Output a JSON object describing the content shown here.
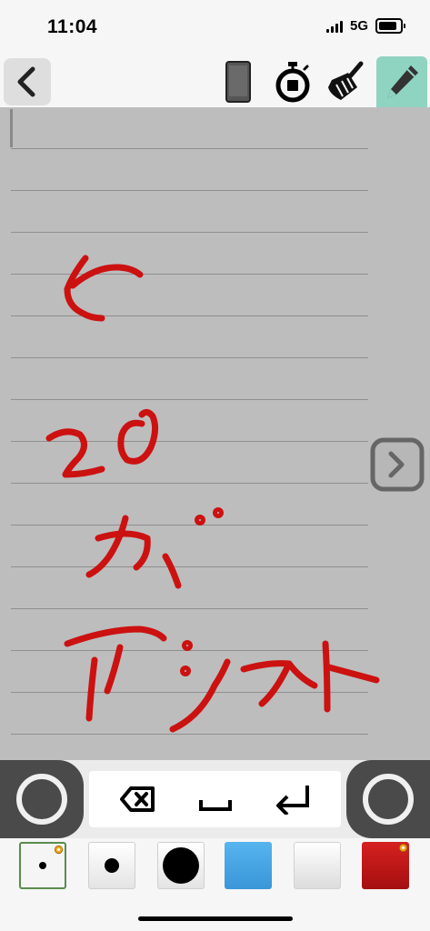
{
  "status_bar": {
    "time": "11:04",
    "network": "5G",
    "icons": [
      "cellular-signal-icon",
      "battery-icon"
    ]
  },
  "toolbar": {
    "back_icon": "chevron-left-icon",
    "tools": [
      "device-phone-icon",
      "stopwatch-icon",
      "broom-clear-icon",
      "pencil-icon"
    ],
    "active_tool": "pencil",
    "active_color": "#8fd3c1"
  },
  "canvas": {
    "background_color": "#bdbdbd",
    "ruled_lines": 15,
    "ink_color": "#cc1111",
    "handwritten_text": [
      "ヒ",
      "2の",
      "が",
      "アシスト"
    ],
    "next_icon": "chevron-right-icon"
  },
  "input_bar": {
    "keys": [
      "backspace-icon",
      "space-icon",
      "return-icon"
    ],
    "left_button": "ring-button",
    "right_button": "ring-button"
  },
  "palette": {
    "pens": [
      "fine",
      "medium",
      "bold"
    ],
    "selected_pen": "fine",
    "colors": [
      {
        "name": "blue",
        "hex": "#3a96d8"
      },
      {
        "name": "white",
        "hex": "#eeeeee"
      },
      {
        "name": "red",
        "hex": "#c01515"
      }
    ],
    "selected_color": "red"
  }
}
